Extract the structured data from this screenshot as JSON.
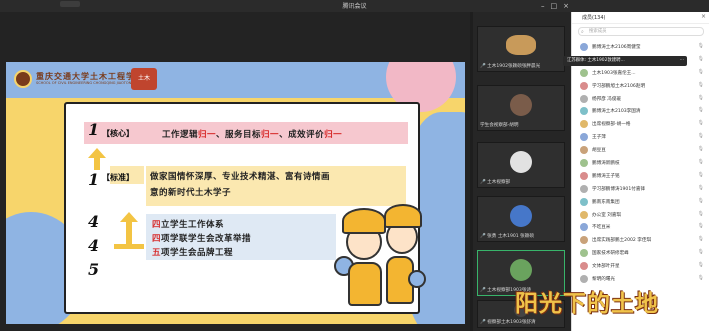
{
  "window": {
    "title": "腾讯会议"
  },
  "slide": {
    "school_name": "重庆交通大学土木工程学院",
    "school_en": "SCHOOL OF CIVIL ENGINEERING CHONGQING JIAOTONG UNIVERSITY",
    "badge": "土木",
    "row1": {
      "num": "1",
      "tag": "核心",
      "text_a": "工作逻辑",
      "hl1": "归一",
      "text_b": "、服务目标",
      "hl2": "归一",
      "text_c": "、成效评价",
      "hl3": "归一"
    },
    "row2": {
      "num": "1",
      "tag": "标准",
      "line1": "做家国情怀深厚、专业技术精湛、富有诗情画",
      "line2": "意的新时代土木学子"
    },
    "digits": [
      "4",
      "4",
      "5"
    ],
    "row3": {
      "l1_num": "四",
      "l1": "立学生工作体系",
      "l2_num": "四",
      "l2": "项学联学生会改革举措",
      "l3_num": "五",
      "l3": "项学生会品牌工程"
    }
  },
  "videos": [
    {
      "label": "🎤 土木1902张颖硕张胖晨光",
      "avatar": "dog"
    },
    {
      "label": "学生会视察部-胡明",
      "avatar": "person"
    },
    {
      "label": "🎤 土木视察部",
      "avatar": "cat"
    },
    {
      "label": "🎤 张勇 土木1901 张颖硕",
      "avatar": "blue"
    },
    {
      "label": "🎤 土木视察部1903张诗",
      "avatar": "green"
    },
    {
      "label": "🎤 视察部土木1903张舒清",
      "avatar": "dark"
    }
  ],
  "members": {
    "title": "成员(134)",
    "search_placeholder": "搜索成员",
    "tooltip": "江苏群体: 土木1902敦建聘...",
    "tooltip_more": "⋯",
    "items": [
      "鹏博涛土木2106周健莹",
      "学长熊土木1902张玉岚",
      "土木1903张嘉伦王...",
      "学习部鹏旭土木2106赵明",
      "杨邦彦 冯俊瑗",
      "鹏博涛土木2103李国清",
      "出席视察部-胡一格",
      "王子萍",
      "胡豆豆",
      "鹏博涛新鹏枝",
      "鹏博涛王子铭",
      "学习部鹏博涛1901付嘉锋",
      "鹏南东南集团",
      "办公室 刘嘉琪",
      "不吃豆米",
      "出席实践部鹏土2002 李佳琪",
      "国家技术研修宏峰",
      "文体部叶开星",
      "黎明的曙光"
    ]
  },
  "watermark": "阳光下的土地",
  "colors": {
    "slide_bg": "#f7d56b",
    "slide_band": "#8fb4e3",
    "highlight_red": "#d72a2a"
  }
}
